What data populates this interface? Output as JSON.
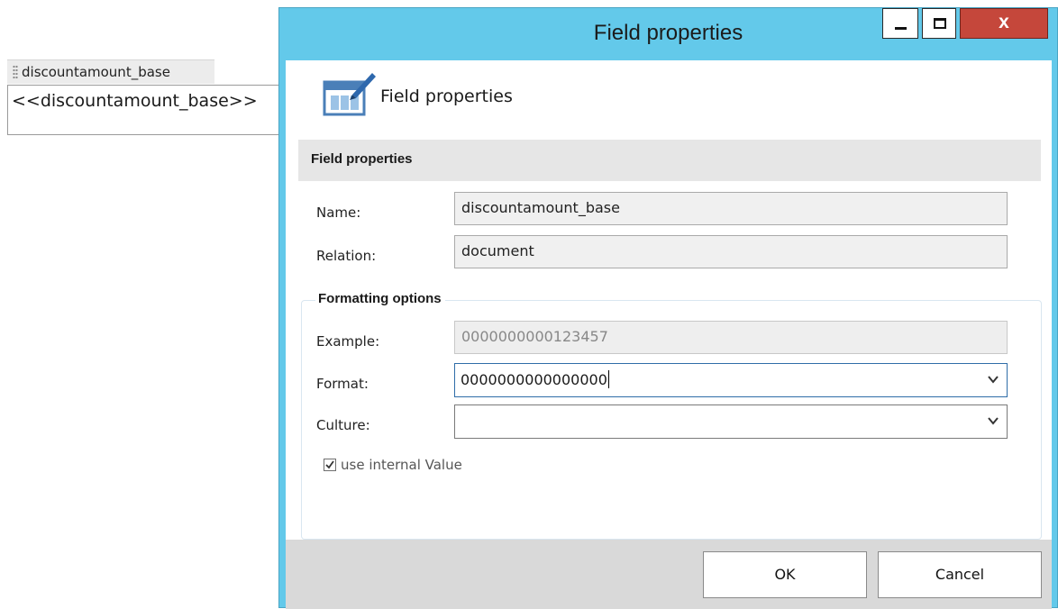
{
  "background": {
    "field_tab_label": "discountamount_base",
    "field_placeholder": "<<discountamount_base>>"
  },
  "dialog": {
    "title": "Field properties",
    "close_label": "x",
    "header_title": "Field properties",
    "section_title": "Field properties",
    "name_label": "Name:",
    "name_value": "discountamount_base",
    "relation_label": "Relation:",
    "relation_value": "document",
    "formatting_title": "Formatting options",
    "example_label": "Example:",
    "example_value": "0000000000123457",
    "format_label": "Format:",
    "format_value": "0000000000000000",
    "culture_label": "Culture:",
    "culture_value": "",
    "checkbox_label": "use internal Value",
    "checkbox_checked": true,
    "ok_label": "OK",
    "cancel_label": "Cancel"
  },
  "colors": {
    "title_bar": "#63c9ea",
    "close_button": "#c5473b",
    "footer": "#d9d9d9"
  }
}
